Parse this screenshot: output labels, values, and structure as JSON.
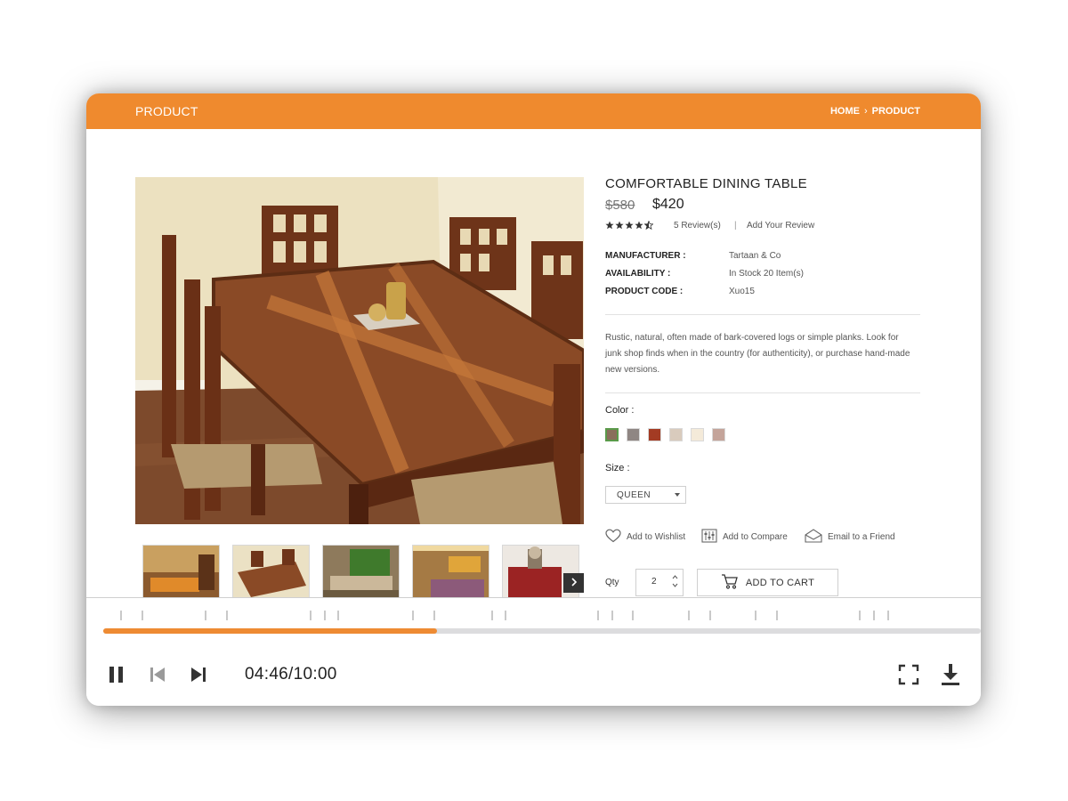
{
  "header": {
    "title": "PRODUCT",
    "breadcrumb": [
      "HOME",
      "PRODUCT"
    ],
    "breadcrumb_separator": "›",
    "color": "#ef8a2e"
  },
  "gallery": {
    "main_image": "dining-table-photo",
    "thumbnails": [
      "living-room-thumb",
      "dining-table-thumb",
      "lounge-thumb",
      "bedroom-thumb",
      "red-chair-thumb"
    ],
    "next_icon": "chevron-right-icon"
  },
  "product": {
    "title": "COMFORTABLE DINING TABLE",
    "old_price": "$580",
    "price": "$420",
    "rating": 4.5,
    "rating_max": 5,
    "reviews_label": "5 Review(s)",
    "review_separator": "|",
    "add_review_label": "Add Your Review",
    "specs": [
      {
        "label": "MANUFACTURER :",
        "value": "Tartaan & Co"
      },
      {
        "label": "AVAILABILITY :",
        "value": "In Stock 20 Item(s)"
      },
      {
        "label": "PRODUCT CODE :",
        "value": "Xuo15"
      }
    ],
    "description": "Rustic, natural, often made of bark-covered logs or simple planks. Look for junk shop finds when in the country (for authenticity), or purchase hand-made new versions.",
    "color_label": "Color :",
    "colors": [
      "#8a6f5c",
      "#8f8683",
      "#a33b23",
      "#d9cbbd",
      "#f4ead9",
      "#c4a49a"
    ],
    "selected_color_index": 0,
    "size_label": "Size :",
    "size_value": "QUEEN",
    "actions": [
      {
        "label": "Add to Wishlist",
        "icon": "heart-icon"
      },
      {
        "label": "Add to Compare",
        "icon": "compare-icon"
      },
      {
        "label": "Email to a Friend",
        "icon": "envelope-icon"
      }
    ],
    "qty_label": "Qty",
    "qty_value": "2",
    "add_to_cart_label": "ADD TO CART"
  },
  "player": {
    "current_time": "04:46",
    "total_time": "10:00",
    "time_display": "04:46/10:00",
    "progress": 0.38,
    "progress_color": "#ee8b33",
    "icons": [
      "pause-icon",
      "skip-back-icon",
      "skip-forward-icon",
      "fullscreen-icon",
      "download-icon"
    ]
  }
}
